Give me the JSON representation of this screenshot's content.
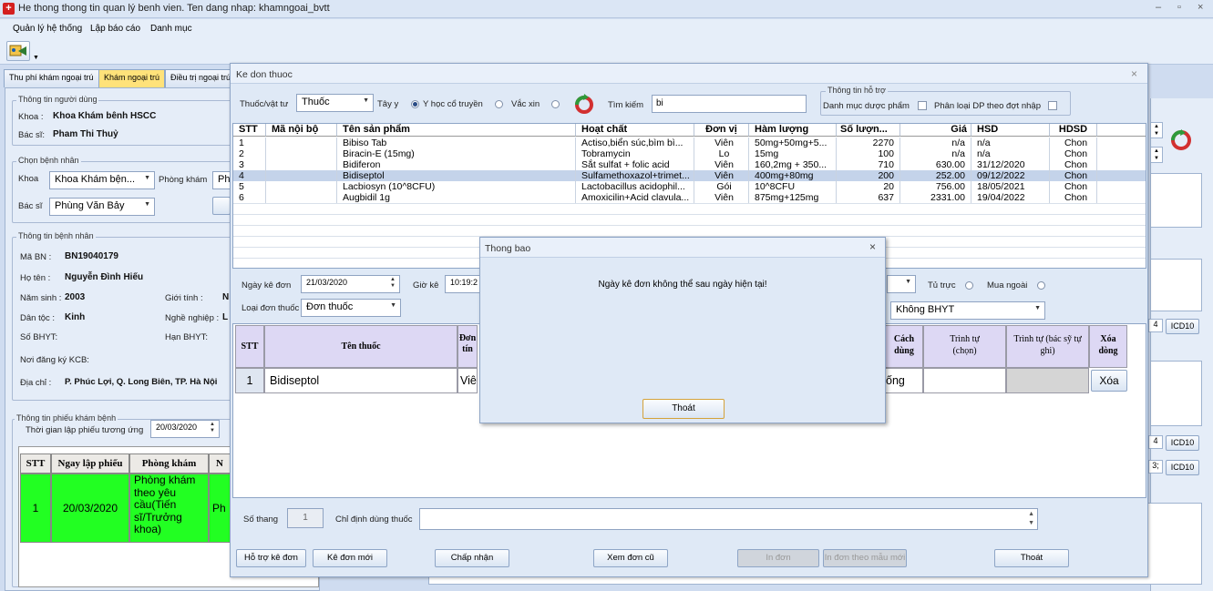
{
  "app": {
    "title": "He thong thong tin quan lý benh vien. Ten dang nhap: khamngoai_bvtt",
    "icon_text": "+",
    "win_min": "–",
    "win_max": "▫",
    "win_close": "×"
  },
  "menu": [
    "Quản lý hệ thống",
    "Lập báo cáo",
    "Danh mục"
  ],
  "tabs": [
    "Thu phí khám ngoại trú",
    "Khám ngoại trú",
    "Điều trị ngoại trú"
  ],
  "left": {
    "user_group": "Thông tin người dùng",
    "khoa_label": "Khoa :",
    "khoa_value": "Khoa Khám bênh  HSCC",
    "bacsi_label": "Bác sĩ:",
    "bacsi_value": "Pham Thi Thuỷ",
    "chon_group": "Chọn bệnh nhân",
    "chon_khoa_label": "Khoa",
    "chon_khoa_value": "Khoa Khám bện...",
    "phongkham_label": "Phòng khám",
    "phongkham_value": "Ph",
    "chon_bacsi_label": "Bác sĩ",
    "chon_bacsi_value": "Phùng Văn Bảy",
    "bn_group": "Thông tin bệnh nhân",
    "mabn_label": "Mã BN :",
    "mabn_value": "BN19040179",
    "hoten_label": "Họ tên :",
    "hoten_value": "Nguyễn Đình Hiếu",
    "namsinh_label": "Năm sinh :",
    "namsinh_value": "2003",
    "gioitinh_label": "Giới tính :",
    "gioitinh_value": "N",
    "dantoc_label": "Dân tộc :",
    "dantoc_value": "Kinh",
    "nghe_label": "Nghề nghiệp :",
    "nghe_value": "L",
    "sobhyt_label": "Số BHYT:",
    "hanbhyt_label": "Hạn BHYT:",
    "noidk_label": "Nơi đăng ký KCB:",
    "diachi_label": "Địa chỉ :",
    "diachi_value": "P. Phúc Lợi, Q. Long Biên, TP. Hà Nội",
    "phieu_group": "Thông tin phiếu khám bệnh",
    "thoigian_label": "Thời gian lập phiếu tương ứng",
    "thoigian_value": "20/03/2020",
    "table_headers": [
      "STT",
      "Ngay lập phiếu",
      "Phòng khám",
      "N"
    ],
    "table_row": [
      "1",
      "20/03/2020",
      "Phòng khám theo yêu cầu(Tiến sĩ/Trưởng khoa)",
      "Ph"
    ]
  },
  "right": {
    "icd1": "ICD10",
    "icd2": "ICD10",
    "icd3": "ICD10",
    "num1": "4",
    "num2": "4",
    "num3": "3;"
  },
  "dialog": {
    "title": "Ke don thuoc",
    "close": "×",
    "thuoc_label": "Thuốc/vật tư",
    "thuoc_value": "Thuốc",
    "tayy_label": "Tây y",
    "yhoc_label": "Y học cổ truyền",
    "vacxin_label": "Vắc xin",
    "timkiem_label": "Tìm kiếm",
    "timkiem_value": "bi",
    "hotro_group": "Thông tin hỗ trợ",
    "danhmuc_label": "Danh mục dược phẩm",
    "phanloai_label": "Phân loại DP theo đợt nhập",
    "grid_headers": [
      "STT",
      "Mã nội bộ",
      "Tên sản phẩm",
      "Hoạt chất",
      "Đơn vị",
      "Hàm lượng",
      "Số lượn...",
      "Giá",
      "HSD",
      "HDSD"
    ],
    "grid_rows": [
      [
        "1",
        "",
        "Bibiso Tab",
        "Actiso,biển súc,bìm bì...",
        "Viên",
        "50mg+50mg+5...",
        "2270",
        "n/a",
        "n/a",
        "Chon"
      ],
      [
        "2",
        "",
        "Biracin-E (15mg)",
        "Tobramycin",
        "Lo",
        "15mg",
        "100",
        "n/a",
        "n/a",
        "Chon"
      ],
      [
        "3",
        "",
        "Bidiferon",
        "Sắt sulfat + folic acid",
        "Viên",
        "160,2mg + 350...",
        "710",
        "630.00",
        "31/12/2020",
        "Chon"
      ],
      [
        "4",
        "",
        "Bidiseptol",
        "Sulfamethoxazol+trimet...",
        "Viên",
        "400mg+80mg",
        "200",
        "252.00",
        "09/12/2022",
        "Chon"
      ],
      [
        "5",
        "",
        "Lacbiosyn (10^8CFU)",
        "Lactobacillus acidophil...",
        "Gói",
        "10^8CFU",
        "20",
        "756.00",
        "18/05/2021",
        "Chon"
      ],
      [
        "6",
        "",
        "Augbidil 1g",
        "Amoxicilin+Acid clavula...",
        "Viên",
        "875mg+125mg",
        "637",
        "2331.00",
        "19/04/2022",
        "Chon"
      ]
    ],
    "ngayke_label": "Ngày kê đơn",
    "ngayke_value": "21/03/2020",
    "gioke_label": "Giờ kê",
    "gioke_value": "10:19:2",
    "loaidon_label": "Loại đơn thuốc",
    "loaidon_value": "Đơn thuốc",
    "tutruc_label": "Tủ trực",
    "muangoai_label": "Mua ngoài",
    "bhyt_value": "Không BHYT",
    "rx_headers": [
      "STT",
      "Tên thuốc",
      "Đơn tín",
      "Cách dùng",
      "Trình tự (chọn)",
      "Trình tự (bác sỹ tự ghi)",
      "Xóa dòng"
    ],
    "rx_row": [
      "1",
      "Bidiseptol",
      "Viê",
      "ống",
      "",
      "",
      "Xóa"
    ],
    "sothang_label": "Số thang",
    "sothang_value": "1",
    "chidinh_label": "Chỉ định dùng thuốc",
    "buttons": [
      "Hỗ trợ kê đơn",
      "Kê đơn mới",
      "Chấp nhận",
      "Xem đơn cũ",
      "In đơn",
      "In đơn theo mẫu mới",
      "Thoát"
    ]
  },
  "message": {
    "title": "Thong bao",
    "close": "×",
    "text": "Ngày kê đơn không thể sau ngày hiện tại!",
    "ok": "Thoát"
  }
}
